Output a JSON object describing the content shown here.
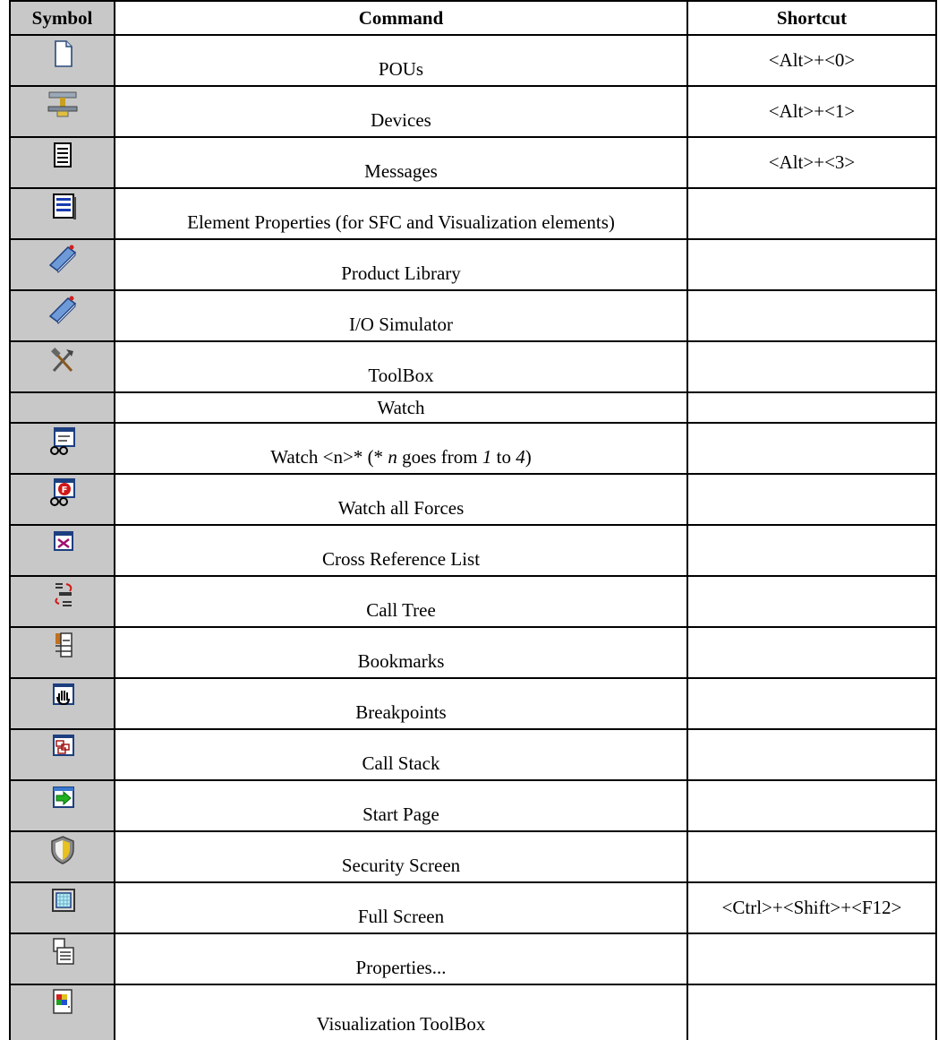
{
  "header": {
    "symbol": "Symbol",
    "command": "Command",
    "shortcut": "Shortcut"
  },
  "rows": [
    {
      "icon": "pou-document-icon",
      "command": "POUs",
      "shortcut": "<Alt>+<0>"
    },
    {
      "icon": "devices-network-icon",
      "command": "Devices",
      "shortcut": "<Alt>+<1>"
    },
    {
      "icon": "messages-list-icon",
      "command": "Messages",
      "shortcut": "<Alt>+<3>"
    },
    {
      "icon": "element-properties-icon",
      "command": "Element Properties (for SFC and Visualization elements)",
      "shortcut": ""
    },
    {
      "icon": "product-library-book-icon",
      "command": "Product Library",
      "shortcut": ""
    },
    {
      "icon": "io-simulator-book-icon",
      "command": "I/O Simulator",
      "shortcut": ""
    },
    {
      "icon": "toolbox-tools-icon",
      "command": "ToolBox",
      "shortcut": ""
    },
    {
      "icon": "",
      "command": "Watch",
      "shortcut": ""
    },
    {
      "icon": "watch-glasses-icon",
      "command": "Watch <n>* (* ",
      "cmd_n": "n",
      "cmd_mid": " goes from ",
      "cmd_one": "1",
      "cmd_to": " to ",
      "cmd_four": "4",
      "cmd_end": ")",
      "shortcut": ""
    },
    {
      "icon": "watch-forces-icon",
      "command": "Watch all Forces",
      "shortcut": ""
    },
    {
      "icon": "cross-reference-icon",
      "command": "Cross Reference List",
      "shortcut": ""
    },
    {
      "icon": "call-tree-icon",
      "command": "Call Tree",
      "shortcut": ""
    },
    {
      "icon": "bookmarks-icon",
      "command": "Bookmarks",
      "shortcut": ""
    },
    {
      "icon": "breakpoints-hand-icon",
      "command": "Breakpoints",
      "shortcut": ""
    },
    {
      "icon": "call-stack-icon",
      "command": "Call Stack",
      "shortcut": ""
    },
    {
      "icon": "start-page-arrow-icon",
      "command": "Start Page",
      "shortcut": ""
    },
    {
      "icon": "security-shield-icon",
      "command": "Security Screen",
      "shortcut": ""
    },
    {
      "icon": "full-screen-icon",
      "command": "Full Screen",
      "shortcut": "<Ctrl>+<Shift>+<F12>"
    },
    {
      "icon": "properties-icon",
      "command": "Properties...",
      "shortcut": ""
    },
    {
      "icon": "visualization-toolbox-icon",
      "command": "Visualization ToolBox",
      "shortcut": ""
    }
  ]
}
